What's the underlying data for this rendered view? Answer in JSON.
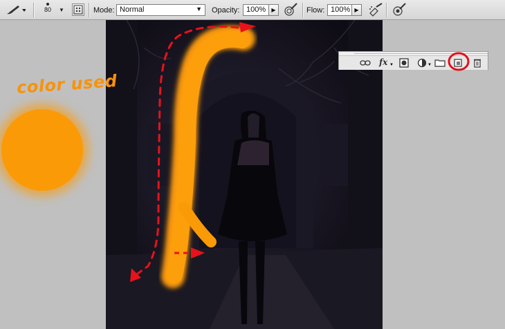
{
  "options_bar": {
    "brush_size": "80",
    "mode_label": "Mode:",
    "mode_value": "Normal",
    "opacity_label": "Opacity:",
    "opacity_value": "100%",
    "flow_label": "Flow:",
    "flow_value": "100%"
  },
  "annotation": {
    "caption": "color used",
    "swatch_color": "#fb9a07",
    "arrow_color": "#e8121c",
    "circle_color": "#e0101a"
  },
  "layers_panel": {
    "buttons": [
      "link-layers",
      "fx",
      "add-layer-mask",
      "adjustment-layer",
      "new-group",
      "new-layer",
      "delete-layer"
    ],
    "fx_label": "fx"
  },
  "colors": {
    "accent_orange": "#fb9a07",
    "canvas_dark": "#15131f"
  }
}
